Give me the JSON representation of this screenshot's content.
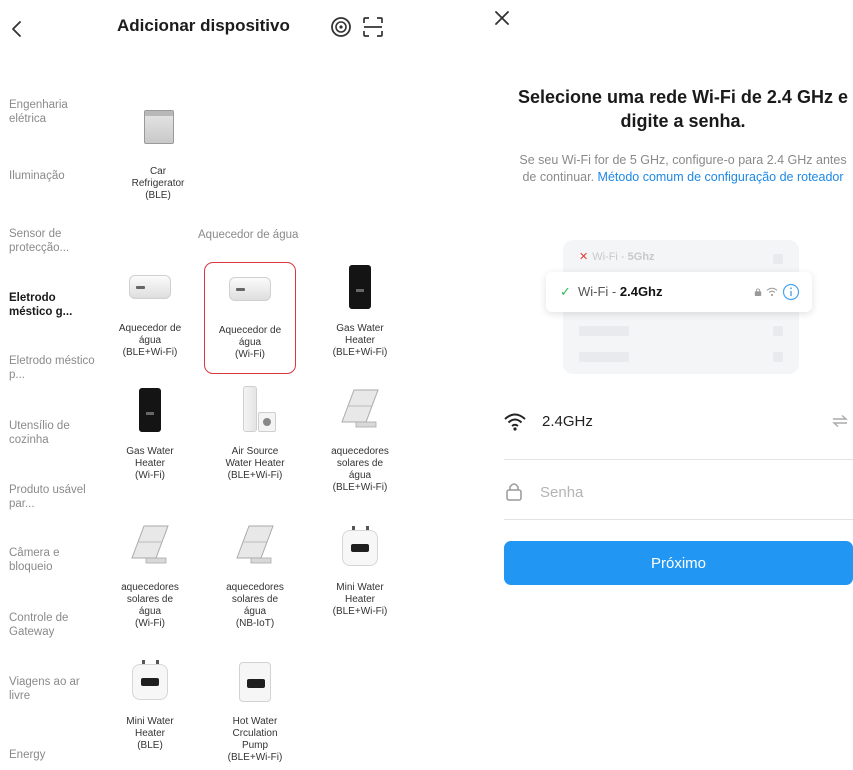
{
  "left_screen": {
    "title": "Adicionar dispositivo",
    "categories": [
      {
        "label": "Engenharia elétrica"
      },
      {
        "label": "Iluminação"
      },
      {
        "label": "Sensor de protecção..."
      },
      {
        "label": "Eletrodo méstico g...",
        "active": true
      },
      {
        "label": "Eletrodo méstico p..."
      },
      {
        "label": "Utensílio de cozinha"
      },
      {
        "label": "Produto usável par..."
      },
      {
        "label": "Câmera e bloqueio"
      },
      {
        "label": "Controle de Gateway"
      },
      {
        "label": "Viagens ao ar livre"
      },
      {
        "label": "Energy"
      }
    ],
    "section_title": "Aquecedor de água",
    "devices": [
      {
        "label": "Car\nRefrigerator\n(BLE)",
        "icon": "car-refrigerator-icon"
      },
      {
        "label": "Aquecedor de\nágua\n(BLE+Wi-Fi)",
        "icon": "water-heater-tank-icon"
      },
      {
        "label": "Aquecedor de\nágua\n(Wi-Fi)",
        "icon": "water-heater-tank-icon",
        "selected": true
      },
      {
        "label": "Gas Water\nHeater\n(BLE+Wi-Fi)",
        "icon": "gas-water-heater-icon"
      },
      {
        "label": "Gas Water\nHeater\n(Wi-Fi)",
        "icon": "gas-water-heater-icon"
      },
      {
        "label": "Air Source\nWater Heater\n(BLE+Wi-Fi)",
        "icon": "air-source-heater-icon"
      },
      {
        "label": "aquecedores\nsolares de\nágua\n(BLE+Wi-Fi)",
        "icon": "solar-heater-icon"
      },
      {
        "label": "aquecedores\nsolares de\nágua\n(Wi-Fi)",
        "icon": "solar-heater-icon"
      },
      {
        "label": "aquecedores\nsolares de\nágua\n(NB-IoT)",
        "icon": "solar-heater-icon"
      },
      {
        "label": "Mini Water\nHeater\n(BLE+Wi-Fi)",
        "icon": "mini-water-heater-icon"
      },
      {
        "label": "Mini Water\nHeater\n(BLE)",
        "icon": "mini-water-heater-icon"
      },
      {
        "label": "Hot Water\nCrculation\nPump\n(BLE+Wi-Fi)",
        "icon": "circulation-pump-icon"
      }
    ]
  },
  "right_screen": {
    "title": "Selecione uma rede Wi-Fi de 2.4 GHz e digite a senha.",
    "desc_prefix": "Se seu Wi-Fi for de 5 GHz, configure-o para 2.4 GHz antes de continuar. ",
    "desc_link": "Método comum de configuração de roteador",
    "wifi_5g_prefix": "Wi-Fi - ",
    "wifi_5g_band": "5Ghz",
    "wifi_24_prefix": "Wi-Fi - ",
    "wifi_24_band": "2.4Ghz",
    "network_name": "2.4GHz",
    "password_placeholder": "Senha",
    "next_label": "Próximo",
    "colors": {
      "accent": "#2196f3",
      "ok": "#2fb85e",
      "error": "#e53935",
      "link": "#1e88e5"
    }
  }
}
